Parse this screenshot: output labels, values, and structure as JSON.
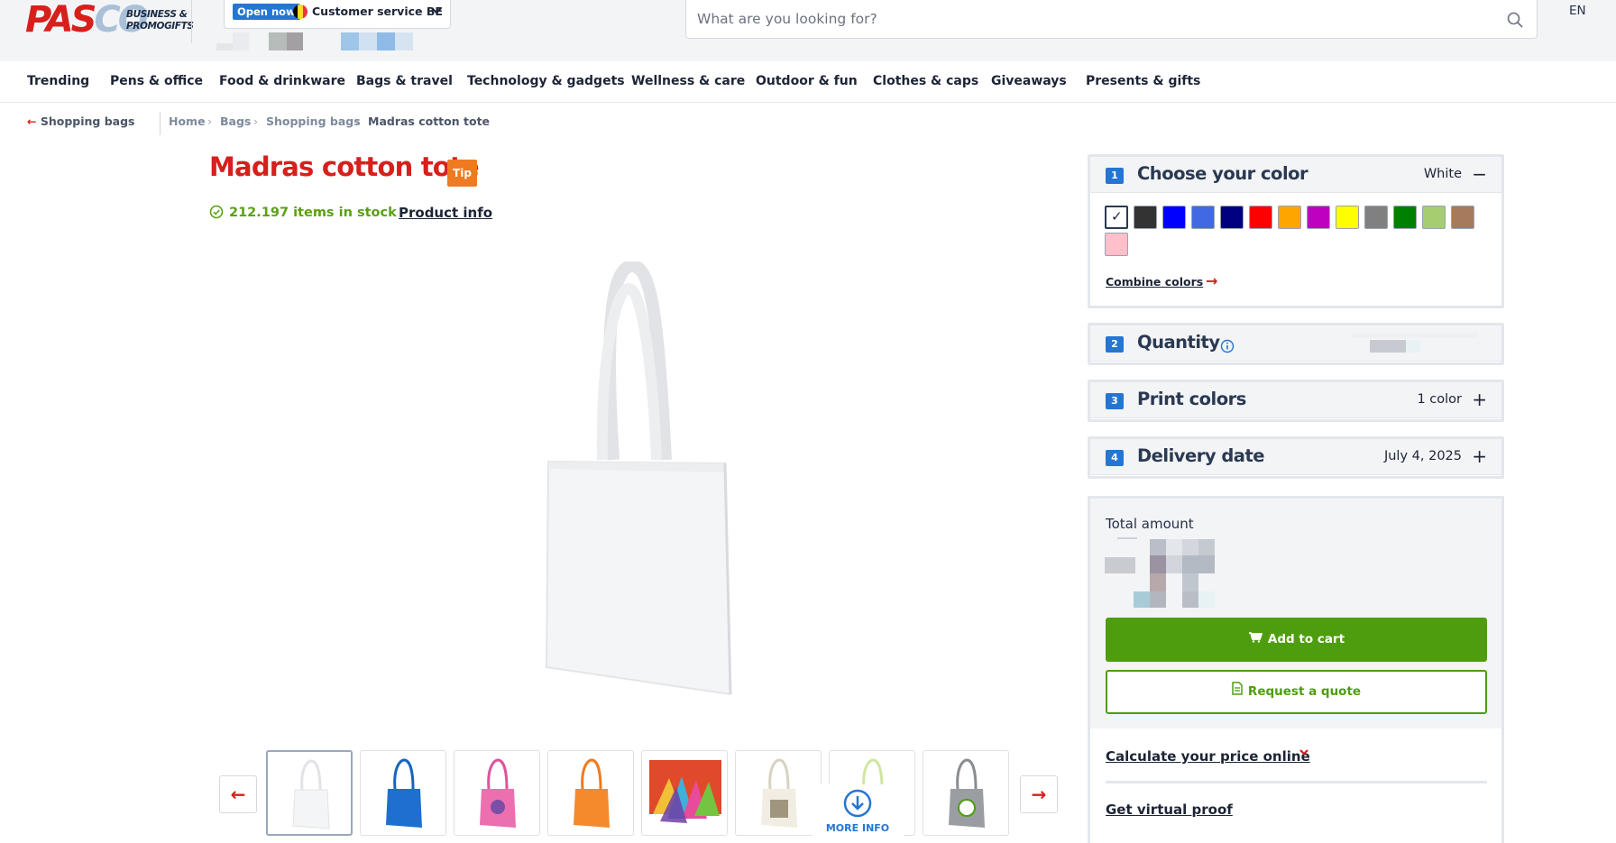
{
  "header": {
    "logo_main": "PASCO",
    "logo_main_red": "PAS",
    "logo_main_blue": "CO",
    "logo_sub_line1": "BUSINESS &",
    "logo_sub_line2": "PROMOGIFTS",
    "open_badge": "Open now",
    "customer_service": "Customer service BE",
    "search_placeholder": "What are you looking for?",
    "language": "EN"
  },
  "nav": {
    "items": [
      "Trending",
      "Pens & office",
      "Food & drinkware",
      "Bags & travel",
      "Technology & gadgets",
      "Wellness & care",
      "Outdoor & fun",
      "Clothes & caps",
      "Giveaways",
      "Presents & gifts"
    ]
  },
  "breadcrumb": {
    "back": "Shopping bags",
    "items": [
      "Home",
      "Bags",
      "Shopping bags",
      "Madras cotton tote"
    ]
  },
  "product": {
    "title": "Madras cotton tote",
    "tip_badge": "Tip",
    "stock": "212.197 items in stock",
    "product_info_link": "Product info",
    "more_info": "MORE INFO",
    "thumbnail_colors": [
      "white",
      "blue",
      "pink",
      "orange",
      "multicolor",
      "natural",
      "lime",
      "grey"
    ]
  },
  "configurator": {
    "color": {
      "step": "1",
      "title": "Choose your color",
      "value": "White",
      "swatches": [
        "#ffffff",
        "#333333",
        "#0000ff",
        "#4169e1",
        "#000080",
        "#ff0000",
        "#ffa500",
        "#c000c0",
        "#ffff00",
        "#808080",
        "#008000",
        "#a6ce6e",
        "#a67b5b",
        "#ffc0cb"
      ],
      "combine_link": "Combine colors"
    },
    "quantity": {
      "step": "2",
      "title": "Quantity"
    },
    "print_colors": {
      "step": "3",
      "title": "Print colors",
      "value": "1 color"
    },
    "delivery": {
      "step": "4",
      "title": "Delivery date",
      "value": "July 4, 2025"
    }
  },
  "summary": {
    "total_label": "Total amount",
    "add_to_cart": "Add to cart",
    "request_quote": "Request a quote",
    "calculate_link": "Calculate your price online",
    "virtual_proof_link": "Get virtual proof"
  },
  "colors": {
    "brand_red": "#d6201c",
    "brand_blue": "#2476d2",
    "green": "#4e9d0f",
    "tip_orange": "#f07a20"
  }
}
